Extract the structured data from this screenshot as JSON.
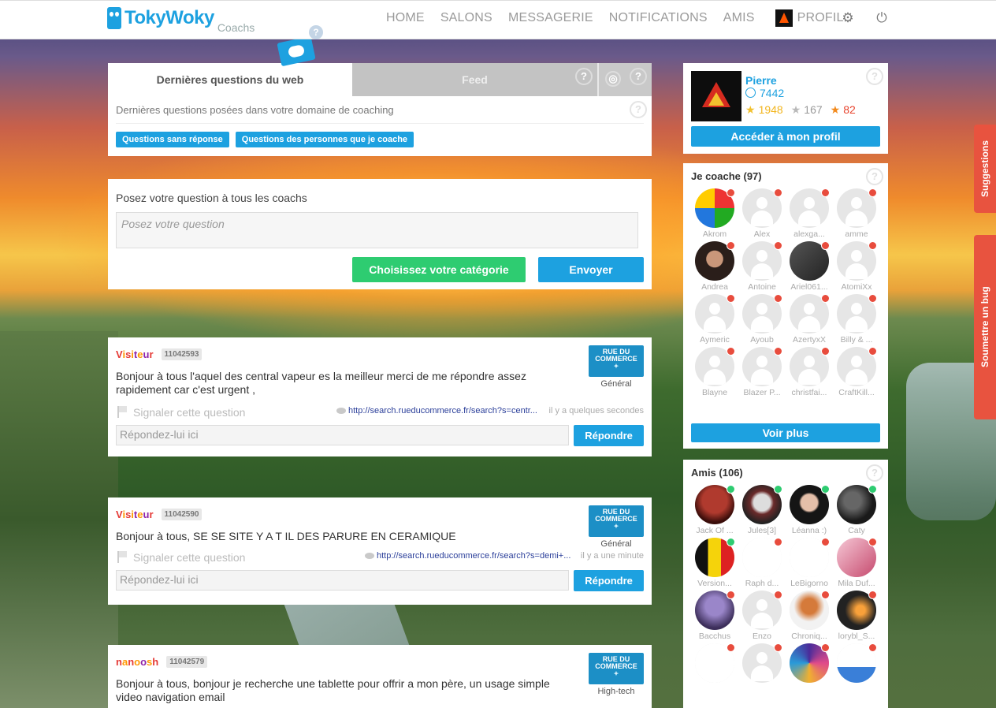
{
  "brand": {
    "name": "TokyWoky",
    "sub": "Coachs"
  },
  "nav": {
    "items": [
      "HOME",
      "SALONS",
      "MESSAGERIE",
      "NOTIFICATIONS",
      "AMIS"
    ],
    "profile_label": "PROFIL",
    "settings_icon": "gear-icon",
    "power_icon": "power-icon"
  },
  "tabs": {
    "items": [
      "Dernières questions du web",
      "Feed"
    ],
    "description": "Dernières questions posées dans votre domaine de coaching",
    "filters": [
      "Questions sans réponse",
      "Questions des personnes que je coache"
    ]
  },
  "ask": {
    "title": "Posez votre question à tous les coachs",
    "placeholder": "Posez votre question",
    "category_button": "Choisissez votre catégorie",
    "send_button": "Envoyer"
  },
  "questions": [
    {
      "user": "Visiteur",
      "id": "11042593",
      "text": "Bonjour à tous l'aquel  des central vapeur es la meilleur merci de me répondre assez rapidement car c'est urgent ,",
      "report": "Signaler cette question",
      "link": "http://search.rueducommerce.fr/search?s=centr...",
      "time": "il y a quelques secondes",
      "reply_placeholder": "Répondez-lui ici",
      "reply_button": "Répondre",
      "brand_line1": "RUE DU",
      "brand_line2": "COMMERCE",
      "category": "Général"
    },
    {
      "user": "Visiteur",
      "id": "11042590",
      "text": "Bonjour à tous, SE SE SITE Y A T IL DES PARURE EN CERAMIQUE",
      "report": "Signaler cette question",
      "link": "http://search.rueducommerce.fr/search?s=demi+...",
      "time": "il y a une minute",
      "reply_placeholder": "Répondez-lui ici",
      "reply_button": "Répondre",
      "brand_line1": "RUE DU",
      "brand_line2": "COMMERCE",
      "category": "Général"
    },
    {
      "user": "nanoosh",
      "id": "11042579",
      "text": "Bonjour à tous, bonjour je recherche une tablette pour offrir a mon père, un usage simple video navigation email",
      "brand_line1": "RUE DU",
      "brand_line2": "COMMERCE",
      "category": "High-tech"
    }
  ],
  "profile": {
    "name": "Pierre",
    "points": "7442",
    "gold": "1948",
    "silver": "167",
    "bronze": "82",
    "button": "Accéder à mon profil"
  },
  "coach": {
    "title": "Je coache (97)",
    "see_more": "Voir plus",
    "people": [
      {
        "name": "Akrom",
        "status": "red",
        "avatar": "photo-windows"
      },
      {
        "name": "Alex",
        "status": "red",
        "avatar": "default"
      },
      {
        "name": "alexga...",
        "status": "red",
        "avatar": "default"
      },
      {
        "name": "amme",
        "status": "red",
        "avatar": "default"
      },
      {
        "name": "Andrea",
        "status": "red",
        "avatar": "photo-face"
      },
      {
        "name": "Antoine",
        "status": "red",
        "avatar": "default"
      },
      {
        "name": "Ariel061...",
        "status": "red",
        "avatar": "photo-chip"
      },
      {
        "name": "AtomiXx",
        "status": "red",
        "avatar": "default"
      },
      {
        "name": "Aymeric",
        "status": "red",
        "avatar": "default"
      },
      {
        "name": "Ayoub",
        "status": "red",
        "avatar": "default"
      },
      {
        "name": "AzertyxX",
        "status": "red",
        "avatar": "default"
      },
      {
        "name": "Billy & ...",
        "status": "red",
        "avatar": "default"
      },
      {
        "name": "Blayne",
        "status": "red",
        "avatar": "default"
      },
      {
        "name": "Blazer P...",
        "status": "red",
        "avatar": "default"
      },
      {
        "name": "christfai...",
        "status": "red",
        "avatar": "default"
      },
      {
        "name": "CraftKill...",
        "status": "red",
        "avatar": "default"
      }
    ]
  },
  "friends": {
    "title": "Amis (106)",
    "people": [
      {
        "name": "Jack Of ...",
        "status": "green",
        "avatar": "photo-red"
      },
      {
        "name": "Jules[3]",
        "status": "green",
        "avatar": "photo-joker"
      },
      {
        "name": "Léanna :)",
        "status": "green",
        "avatar": "photo-girl"
      },
      {
        "name": "Caty",
        "status": "green",
        "avatar": "photo-dark"
      },
      {
        "name": "Version...",
        "status": "green",
        "avatar": "photo-flag"
      },
      {
        "name": "Raph d...",
        "status": "red",
        "avatar": "photo-tokywoky"
      },
      {
        "name": "LeBigorno",
        "status": "red",
        "avatar": "photo-bigorno"
      },
      {
        "name": "Mila Duf...",
        "status": "red",
        "avatar": "photo-pink"
      },
      {
        "name": "Bacchus",
        "status": "red",
        "avatar": "photo-purple"
      },
      {
        "name": "Enzo",
        "status": "red",
        "avatar": "default"
      },
      {
        "name": "Chroniq...",
        "status": "red",
        "avatar": "photo-figure"
      },
      {
        "name": "lorybl_S...",
        "status": "red",
        "avatar": "photo-space"
      },
      {
        "name": "",
        "status": "red",
        "avatar": "photo-key"
      },
      {
        "name": "",
        "status": "red",
        "avatar": "default"
      },
      {
        "name": "",
        "status": "red",
        "avatar": "photo-art"
      },
      {
        "name": "",
        "status": "red",
        "avatar": "photo-boat"
      }
    ]
  },
  "side_tabs": [
    "Suggestions",
    "Soumettre un bug"
  ],
  "colors": {
    "accent": "#1da1e0",
    "green": "#2ecc71",
    "red": "#e84c3d",
    "side_tab": "#e8533f"
  }
}
